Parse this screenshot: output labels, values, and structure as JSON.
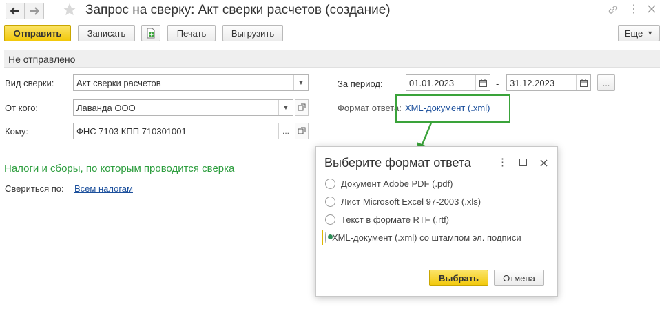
{
  "window": {
    "title": "Запрос на сверку: Акт сверки расчетов (создание)"
  },
  "toolbar": {
    "send_label": "Отправить",
    "save_label": "Записать",
    "print_label": "Печать",
    "export_label": "Выгрузить",
    "more_label": "Еще"
  },
  "status": {
    "text": "Не отправлено"
  },
  "form": {
    "type_label": "Вид сверки:",
    "type_value": "Акт сверки расчетов",
    "from_label": "От кого:",
    "from_value": "Лаванда ООО",
    "to_label": "Кому:",
    "to_value": "ФНС 7103 КПП 710301001",
    "period_label": "За период:",
    "period_from": "01.01.2023",
    "period_sep": "-",
    "period_to": "31.12.2023",
    "period_more": "...",
    "format_label": "Формат ответа:",
    "format_value": "XML-документ (.xml)"
  },
  "taxes": {
    "section_title": "Налоги и сборы, по которым проводится сверка",
    "reconcile_label": "Свериться по:",
    "reconcile_value": "Всем налогам"
  },
  "dialog": {
    "title": "Выберите формат ответа",
    "options": [
      {
        "label": "Документ Adobe PDF (.pdf)",
        "selected": false
      },
      {
        "label": "Лист Microsoft Excel 97-2003 (.xls)",
        "selected": false
      },
      {
        "label": "Текст в формате RTF (.rtf)",
        "selected": false
      },
      {
        "label": "XML-документ (.xml) со штампом эл. подписи",
        "selected": true
      }
    ],
    "select_label": "Выбрать",
    "cancel_label": "Отмена"
  },
  "colors": {
    "accent_yellow": "#f2c80a",
    "highlight_green": "#3aa33a",
    "section_green": "#2e9e3f",
    "link_blue": "#1b4f9c"
  }
}
